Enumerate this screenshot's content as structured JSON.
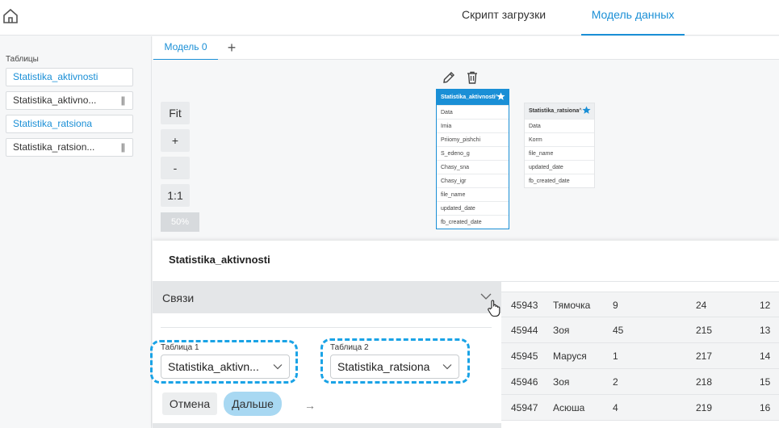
{
  "header": {
    "tabs": [
      {
        "label": "Скрипт загрузки"
      },
      {
        "label": "Модель данных"
      }
    ]
  },
  "sidebar": {
    "title": "Таблицы",
    "items": [
      {
        "label": "Statistika_aktivnosti"
      },
      {
        "label": "Statistika_aktivno..."
      },
      {
        "label": "Statistika_ratsiona"
      },
      {
        "label": "Statistika_ratsion..."
      }
    ],
    "drag_glyph": "||"
  },
  "model_tabs": {
    "active": "Модель 0",
    "add": "+"
  },
  "zoom": {
    "fit": "Fit",
    "plus": "+",
    "minus": "-",
    "one_to_one": "1:1",
    "level": "50%"
  },
  "canvas": {
    "table1": {
      "name": "Statistika_aktivnosti",
      "fields": [
        "Data",
        "Imia",
        "Priiomy_pishchi",
        "S_edeno_g",
        "Chasy_sna",
        "Chasy_igr",
        "file_name",
        "updated_date",
        "fb_created_date"
      ]
    },
    "table2": {
      "name": "Statistika_ratsiona",
      "fields": [
        "Data",
        "Korm",
        "file_name",
        "updated_date",
        "fb_created_date"
      ]
    }
  },
  "panel": {
    "title": "Statistika_aktivnosti",
    "links_title": "Связи",
    "table1_label": "Таблица 1",
    "table1_value": "Statistika_aktivn...",
    "table2_label": "Таблица 2",
    "table2_value": "Statistika_ratsiona",
    "arrow": "→",
    "cancel": "Отмена",
    "next": "Дальше"
  },
  "data_rows": [
    [
      "45943",
      "Тямочка",
      "9",
      "24",
      "12"
    ],
    [
      "45944",
      "Зоя",
      "45",
      "215",
      "13"
    ],
    [
      "45945",
      "Маруся",
      "1",
      "217",
      "14"
    ],
    [
      "45946",
      "Зоя",
      "2",
      "218",
      "15"
    ],
    [
      "45947",
      "Асюша",
      "4",
      "219",
      "16"
    ]
  ],
  "colors": {
    "accent": "#1a8fd6",
    "dashed_highlight": "#1aa3e6",
    "next_button": "#a8d8f2"
  }
}
